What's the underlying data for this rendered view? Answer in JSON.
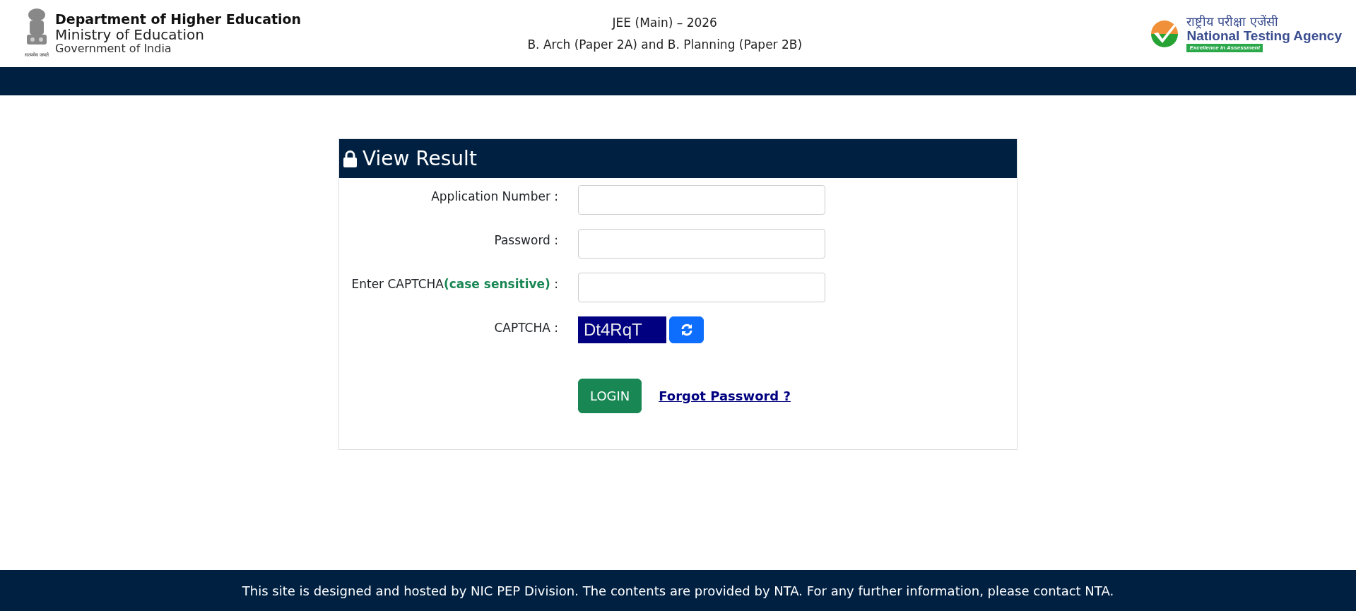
{
  "header": {
    "emblem_motto": "सत्यमेव जयते",
    "department": "Department of Higher Education",
    "ministry": "Ministry of Education",
    "government": "Government of India",
    "exam_title": "JEE (Main) – 2026",
    "exam_subtitle": "B. Arch (Paper 2A) and B. Planning (Paper 2B)",
    "agency_hindi": "राष्ट्रीय परीक्षा एजेंसी",
    "agency_name": "National Testing Agency",
    "agency_tagline": "Excellence in Assessment"
  },
  "form": {
    "title": "View Result",
    "fields": [
      {
        "label": "Application Number :"
      },
      {
        "label": "Password :"
      },
      {
        "label": "Enter CAPTCHA**(case sensitive)** :"
      }
    ],
    "captcha_label": "CAPTCHA :",
    "captcha_text": "Dt4RqT",
    "login_button": "LOGIN",
    "forgot_link": "Forgot Password ?"
  },
  "footer": "This site is designed and hosted by NIC PEP Division. The contents are provided by NTA. For any further information, please contact NTA."
}
